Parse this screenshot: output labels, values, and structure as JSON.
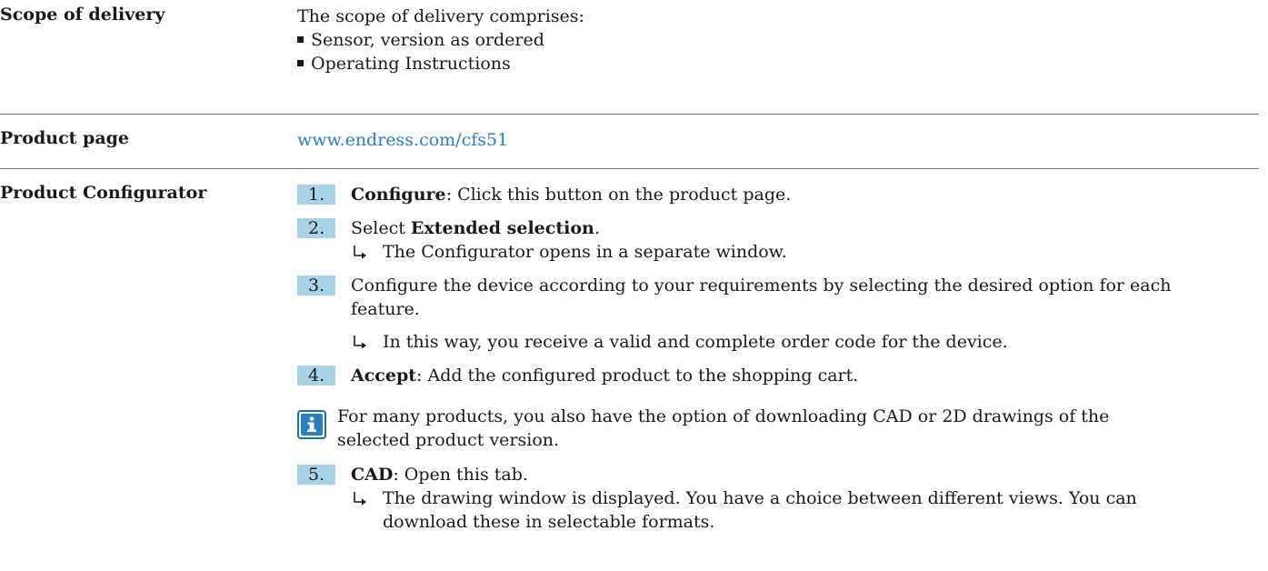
{
  "scope": {
    "label": "Scope of delivery",
    "intro": "The scope of delivery comprises:",
    "items": [
      "Sensor, version as ordered",
      "Operating Instructions"
    ]
  },
  "product_page": {
    "label": "Product page",
    "link": "www.endress.com/cfs51"
  },
  "configurator": {
    "label": "Product Configurator",
    "step1": {
      "num": "1.",
      "bold": "Configure",
      "text": ": Click this button on the product page."
    },
    "step2": {
      "num": "2.",
      "pre": "Select ",
      "bold": "Extended selection",
      "post": ".",
      "result": "The Configurator opens in a separate window."
    },
    "step3": {
      "num": "3.",
      "line1": "Configure the device according to your requirements by selecting the desired option for each",
      "line2": "feature.",
      "result": "In this way, you receive a valid and complete order code for the device."
    },
    "step4": {
      "num": "4.",
      "bold": "Accept",
      "text": ": Add the configured product to the shopping cart."
    },
    "note": {
      "line1": "For many products, you also have the option of downloading CAD or 2D drawings of the",
      "line2": "selected product version."
    },
    "step5": {
      "num": "5.",
      "bold": "CAD",
      "text": ": Open this tab.",
      "result_line1": "The drawing window is displayed. You have a choice between different views. You can",
      "result_line2": "download these in selectable formats."
    }
  },
  "colors": {
    "accent": "#2b7ec0",
    "step_bg": "#a8d3e7",
    "rule": "#6e6e6e"
  }
}
